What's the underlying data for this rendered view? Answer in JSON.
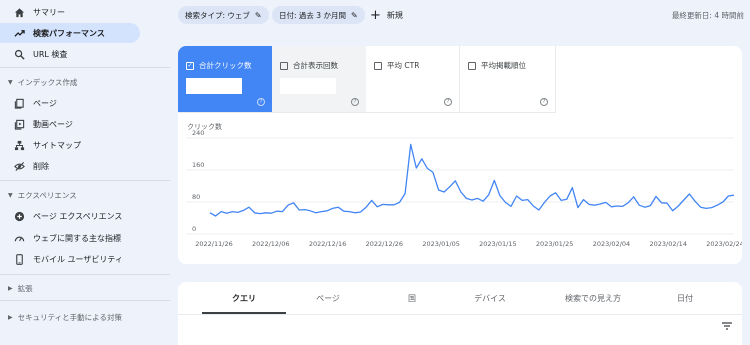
{
  "sidebar": {
    "items": [
      {
        "label": "サマリー",
        "icon": "home-icon"
      },
      {
        "label": "検索パフォーマンス",
        "icon": "trending-up-icon"
      },
      {
        "label": "URL 検査",
        "icon": "search-icon"
      }
    ],
    "sections": [
      {
        "label": "インデックス作成",
        "items": [
          {
            "label": "ページ",
            "icon": "pages-icon"
          },
          {
            "label": "動画ページ",
            "icon": "video-page-icon"
          },
          {
            "label": "サイトマップ",
            "icon": "sitemap-icon"
          },
          {
            "label": "削除",
            "icon": "eye-off-icon"
          }
        ]
      },
      {
        "label": "エクスペリエンス",
        "items": [
          {
            "label": "ページ エクスペリエンス",
            "icon": "plus-circle-icon"
          },
          {
            "label": "ウェブに関する主な指標",
            "icon": "speed-icon"
          },
          {
            "label": "モバイル ユーザビリティ",
            "icon": "phone-icon"
          }
        ]
      }
    ],
    "collapsed": [
      {
        "label": "拡張"
      },
      {
        "label": "セキュリティと手動による対策"
      }
    ]
  },
  "filters": {
    "search_type": "検索タイプ: ウェブ",
    "date": "日付: 過去 3 か月間",
    "new_label": "新規",
    "updated": "最終更新日: 4 時間前"
  },
  "metrics": [
    {
      "label": "合計クリック数",
      "checked": true,
      "accent": "#4285f4"
    },
    {
      "label": "合計表示回数",
      "checked": false
    },
    {
      "label": "平均 CTR",
      "checked": false
    },
    {
      "label": "平均掲載順位",
      "checked": false
    }
  ],
  "tabs": [
    {
      "label": "クエリ",
      "active": true
    },
    {
      "label": "ページ",
      "active": false
    },
    {
      "label": "国",
      "active": false
    },
    {
      "label": "デバイス",
      "active": false
    },
    {
      "label": "検索での見え方",
      "active": false
    },
    {
      "label": "日付",
      "active": false
    }
  ],
  "chart_data": {
    "type": "line",
    "ylabel": "クリック数",
    "ylim": [
      0,
      240
    ],
    "yticks": [
      0,
      80,
      160,
      240
    ],
    "xticks": [
      "2022/11/26",
      "2022/12/06",
      "2022/12/16",
      "2022/12/26",
      "2023/01/05",
      "2023/01/15",
      "2023/01/25",
      "2023/02/04",
      "2023/02/14",
      "2023/02/24"
    ],
    "line_color": "#4285f4",
    "series": [
      {
        "values": [
          53,
          45,
          56,
          52,
          56,
          54,
          59,
          67,
          53,
          51,
          53,
          52,
          57,
          56,
          72,
          78,
          60,
          61,
          58,
          53,
          56,
          58,
          64,
          67,
          57,
          56,
          53,
          55,
          67,
          84,
          68,
          74,
          73,
          73,
          79,
          101,
          224,
          165,
          188,
          164,
          154,
          110,
          105,
          118,
          133,
          105,
          89,
          85,
          89,
          82,
          98,
          134,
          96,
          79,
          69,
          95,
          84,
          86,
          70,
          60,
          79,
          95,
          103,
          84,
          87,
          116,
          66,
          86,
          74,
          72,
          75,
          79,
          68,
          70,
          69,
          78,
          93,
          72,
          67,
          71,
          94,
          78,
          77,
          58,
          70,
          85,
          100,
          82,
          67,
          64,
          66,
          72,
          80,
          95,
          97
        ]
      }
    ]
  }
}
